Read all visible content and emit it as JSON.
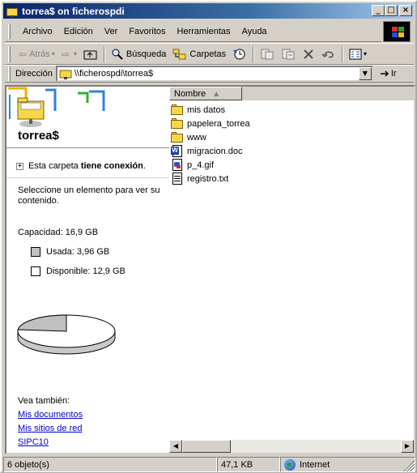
{
  "window": {
    "title": "torrea$ on ficherospdi",
    "minimize": "_",
    "maximize": "□",
    "close": "×"
  },
  "menu": {
    "items": [
      "Archivo",
      "Edición",
      "Ver",
      "Favoritos",
      "Herramientas",
      "Ayuda"
    ]
  },
  "toolbar": {
    "back": "Atrás",
    "search": "Búsqueda",
    "folders": "Carpetas"
  },
  "address": {
    "label": "Dirección",
    "value": "\\\\ficherospdi\\torrea$",
    "go": "Ir"
  },
  "left_pane": {
    "title": "torrea$",
    "connection_prefix": "Esta carpeta",
    "connection_bold": "tiene conexión",
    "connection_suffix": ".",
    "description": "Seleccione un elemento para ver su contenido.",
    "capacity": "Capacidad: 16,9 GB",
    "used": "Usada: 3,96 GB",
    "free": "Disponible: 12,9 GB",
    "used_fraction": 0.234,
    "see_also": "Vea también:",
    "links": [
      "Mis documentos",
      "Mis sitios de red",
      "SIPC10"
    ]
  },
  "right_pane": {
    "column_name": "Nombre",
    "files": [
      {
        "name": "mis datos",
        "type": "folder"
      },
      {
        "name": "papelera_torrea",
        "type": "folder"
      },
      {
        "name": "www",
        "type": "folder"
      },
      {
        "name": "migracion.doc",
        "type": "doc"
      },
      {
        "name": "p_4.gif",
        "type": "gif"
      },
      {
        "name": "registro.txt",
        "type": "txt"
      }
    ]
  },
  "status": {
    "objects": "6 objeto(s)",
    "size": "47,1 KB",
    "zone": "Internet"
  },
  "colors": {
    "title_start": "#0a246a",
    "title_end": "#a6caf0",
    "face": "#d4d0c8",
    "link": "#0000cc",
    "used_slice": "#c0c0c0"
  }
}
